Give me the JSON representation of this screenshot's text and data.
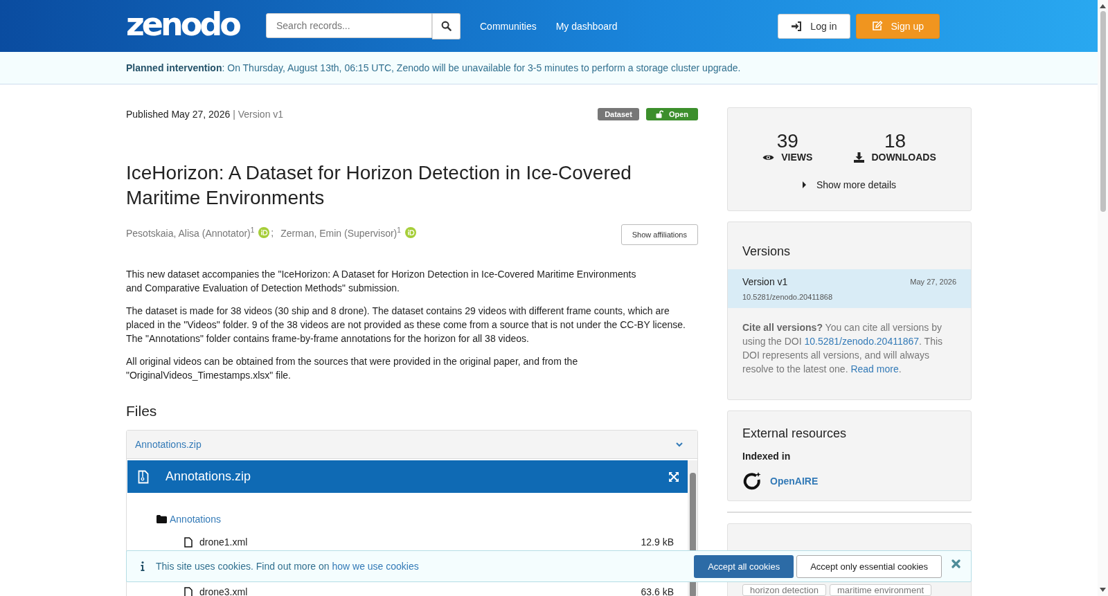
{
  "header": {
    "logo": "zenodo",
    "search": {
      "placeholder": "Search records..."
    },
    "nav": [
      "Communities",
      "My dashboard"
    ],
    "login": "Log in",
    "signup": "Sign up"
  },
  "notice": "**Planned intervention**: On Thursday, August 13th, 06:15 UTC, Zenodo will be unavailable for 3-5 minutes to perform a storage cluster upgrade.",
  "record": {
    "published": "Published May 27, 2026",
    "version": "| Version v1",
    "badges": [
      {
        "label": "Dataset",
        "kind": "type"
      },
      {
        "label": "Open",
        "kind": "access"
      }
    ],
    "title": "IceHorizon: A Dataset for Horizon Detection in Ice-Covered Maritime Environments",
    "authors": [
      {
        "name": "Pesotskaia, Alisa (Annotator)$^{1}$",
        "sep": ";"
      },
      {
        "name": "Zerman, Emin (Supervisor)$^{1}$"
      }
    ],
    "show_affiliations": "Show affiliations",
    "description": [
      "This new dataset accompanies the \"IceHorizon: A Dataset for Horizon Detection in Ice-Covered Maritime Environments\nand Comparative Evaluation of Detection Methods\" submission.",
      "The dataset is made for 38 videos (30 ship and 8 drone). The dataset contains 29 videos with different frame counts, which are placed in the \"Videos\" folder. 9 of the 38 videos are not provided as these come from a source that is not under the CC-BY license. The \"Annotations\" folder contains frame-by-frame annotations for the horizon for all 38 videos.",
      "All original videos can be obtained from the sources that were provided in the original paper, and from the\n\"OriginalVideos_Timestamps.xlsx\" file."
    ]
  },
  "files": {
    "heading": "Files",
    "accordion": {
      "label": "Annotations.zip",
      "expanded": true
    },
    "preview_title": "Annotations.zip",
    "tree": [
      {
        "name": "Annotations",
        "children": [
          {
            "name": "drone1.xml",
            "size": "12.9 kB"
          },
          {
            "name": "drone3.xml",
            "size": "63.6 kB"
          }
        ]
      }
    ]
  },
  "stats": {
    "views": "39",
    "views_label": "VIEWS",
    "downloads": "18",
    "downloads_label": "DOWNLOADS",
    "more": "Show more details"
  },
  "versions": {
    "title": "Versions",
    "items": [
      {
        "name": "Version v1",
        "date": "May 27, 2026",
        "doi": "10.5281/zenodo.20411868",
        "selected": true
      }
    ],
    "cite_bold": "Cite all versions?",
    "cite_a": " You can cite all versions by using the DOI ",
    "cite_doi": "10.5281/zenodo.20411867",
    "cite_b": ". This DOI represents all versions, and will always resolve to the latest one. ",
    "read_more": "Read more",
    "cite_end": "."
  },
  "external": {
    "title": "External resources",
    "indexed": "Indexed in",
    "link": "OpenAIRE"
  },
  "keywords": [
    "horizon detection",
    "maritime environment"
  ],
  "cookies": {
    "text": "This site uses cookies. Find out more on ",
    "link": "how we use cookies",
    "accept_all": "Accept all cookies",
    "accept_essential": "Accept only essential cookies"
  }
}
